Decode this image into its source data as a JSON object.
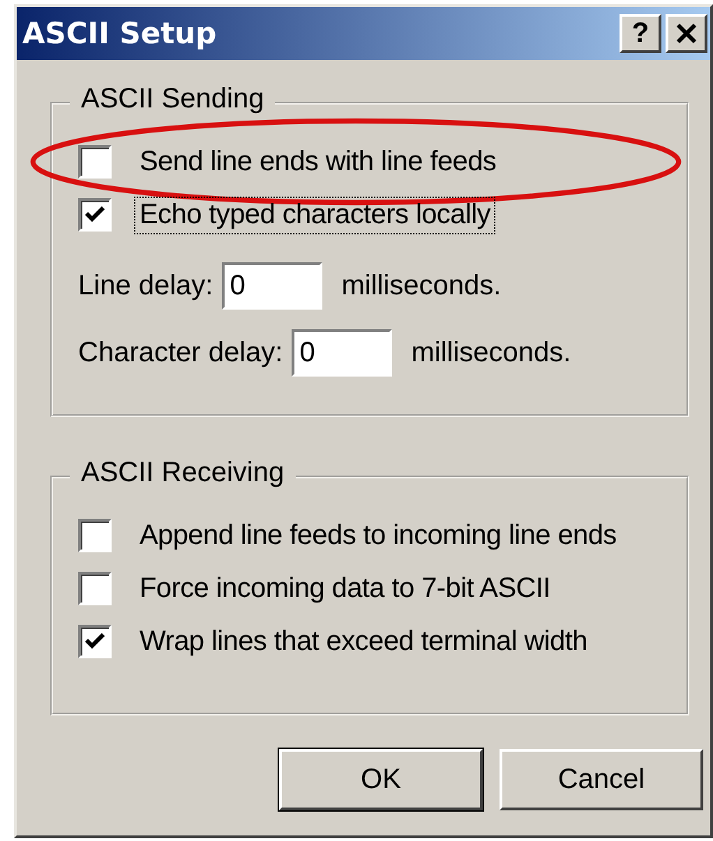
{
  "window": {
    "title": "ASCII Setup",
    "help_button": "?"
  },
  "groups": [
    {
      "title": "ASCII Sending",
      "items": [
        {
          "kind": "checkbox",
          "label": "Send line ends with line feeds",
          "checked": false,
          "focused": false,
          "highlighted": true
        },
        {
          "kind": "checkbox",
          "label": "Echo typed characters locally",
          "checked": true,
          "focused": true,
          "highlighted": false
        },
        {
          "kind": "number",
          "label": "Line delay:",
          "value": "0",
          "unit": "milliseconds."
        },
        {
          "kind": "number",
          "label": "Character delay:",
          "value": "0",
          "unit": "milliseconds."
        }
      ]
    },
    {
      "title": "ASCII Receiving",
      "items": [
        {
          "kind": "checkbox",
          "label": "Append line feeds to incoming line ends",
          "checked": false,
          "focused": false,
          "highlighted": false
        },
        {
          "kind": "checkbox",
          "label": "Force incoming data to 7-bit ASCII",
          "checked": false,
          "focused": false,
          "highlighted": false
        },
        {
          "kind": "checkbox",
          "label": "Wrap lines that exceed terminal width",
          "checked": true,
          "focused": false,
          "highlighted": false
        }
      ]
    }
  ],
  "buttons": [
    {
      "label": "OK",
      "default": true
    },
    {
      "label": "Cancel",
      "default": false
    }
  ]
}
